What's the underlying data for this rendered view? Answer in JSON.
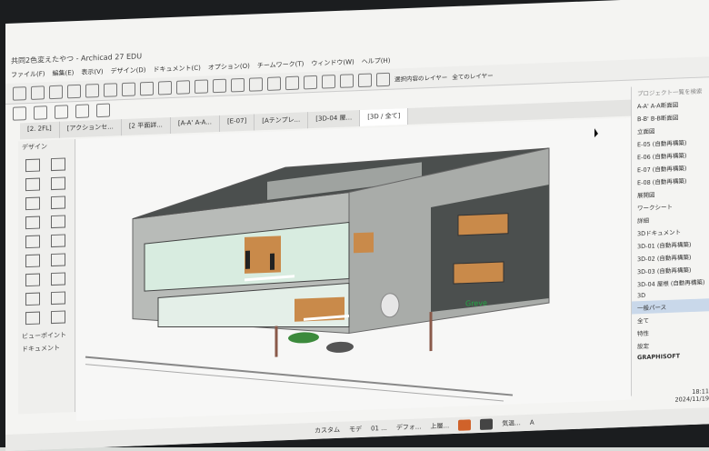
{
  "window": {
    "title": "共同2色変えたやつ - Archicad 27 EDU"
  },
  "menu": [
    "ファイル(F)",
    "編集(E)",
    "表示(V)",
    "デザイン(D)",
    "ドキュメント(C)",
    "オプション(O)",
    "チームワーク(T)",
    "ウィンドウ(W)",
    "ヘルプ(H)"
  ],
  "toolbar": {
    "layer_label_1": "選択内容のレイヤー",
    "layer_label_2": "全てのレイヤー"
  },
  "tabs": [
    "[2. 2FL]",
    "[アクションセ...",
    "[2 平面詳...",
    "[A-A' A-A...",
    "[E-07]",
    "[Aテンプレ...",
    "[3D-04 屋...",
    "[3D / 全て]"
  ],
  "left_panel": {
    "design_label": "デザイン",
    "viewpoint_label": "ビューポイント",
    "document_label": "ドキュメント"
  },
  "right_panel": {
    "search_placeholder": "プロジェクト一覧を検索",
    "items": [
      "A-A' A-A断面図",
      "B-B' B-B断面図",
      "立面図",
      "E-05 (自動再構築)",
      "E-06 (自動再構築)",
      "E-07 (自動再構築)",
      "E-08 (自動再構築)",
      "展開図",
      "ワークシート",
      "詳細",
      "3Dドキュメント",
      "3D-01 (自動再構築)",
      "3D-02 (自動再構築)",
      "3D-03 (自動再構築)",
      "3D-04 屋根 (自動再構築)",
      "3D",
      "一般パース",
      "全て"
    ],
    "selected_item": "一般パース",
    "props_label": "特性",
    "settings_label": "設定"
  },
  "statusbar": {
    "custom": "カスタム",
    "model": "モデ",
    "floor": "01 ...",
    "default": "デフォ...",
    "top": "上層..."
  },
  "taskbar": {
    "weather": "気温...",
    "lang": "A"
  },
  "clock": {
    "time": "18:11",
    "date": "2024/11/19"
  },
  "building": {
    "sign": "Greve"
  },
  "colors": {
    "concrete": "#b8bbb8",
    "roof": "#4b4f4e",
    "wood": "#c98a4a",
    "glass": "#d8ece0",
    "grass": "#3c8a3c"
  },
  "footer": {
    "brand": "GRAPHISOFT"
  }
}
